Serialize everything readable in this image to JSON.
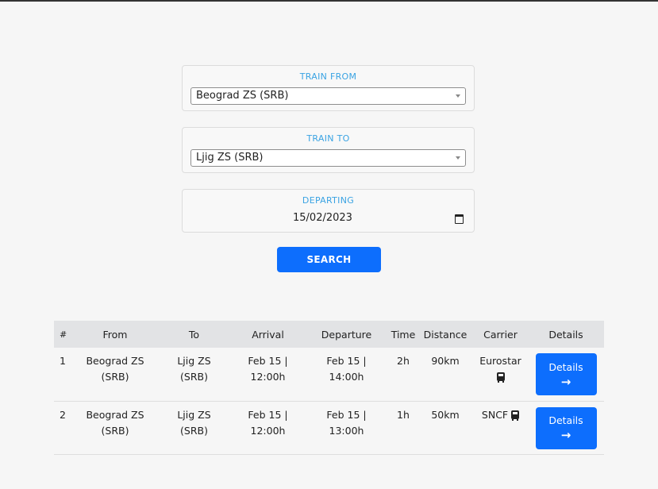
{
  "form": {
    "from_label": "TRAIN FROM",
    "from_value": "Beograd ZS (SRB)",
    "to_label": "TRAIN TO",
    "to_value": "Ljig ZS (SRB)",
    "departing_label": "DEPARTING",
    "departing_value": "15/02/2023",
    "search_label": "SEARCH"
  },
  "table": {
    "headers": [
      "#",
      "From",
      "To",
      "Arrival",
      "Departure",
      "Time",
      "Distance",
      "Carrier",
      "Details"
    ],
    "rows": [
      {
        "num": "1",
        "from": "Beograd ZS (SRB)",
        "to": "Ljig ZS (SRB)",
        "arrival": "Feb 15 | 12:00h",
        "departure": "Feb 15 | 14:00h",
        "time": "2h",
        "distance": "90km",
        "carrier": "Eurostar",
        "carrier_icon": "bus-icon",
        "details": "Details",
        "details_icon": "arrow-right-icon"
      },
      {
        "num": "2",
        "from": "Beograd ZS (SRB)",
        "to": "Ljig ZS (SRB)",
        "arrival": "Feb 15 | 12:00h",
        "departure": "Feb 15 | 13:00h",
        "time": "1h",
        "distance": "50km",
        "carrier": "SNCF",
        "carrier_icon": "bus-icon",
        "details": "Details",
        "details_icon": "arrow-right-icon"
      }
    ]
  },
  "colors": {
    "accent": "#0d6efd",
    "label": "#3aa3e3",
    "header_bg": "#e2e3e5"
  }
}
